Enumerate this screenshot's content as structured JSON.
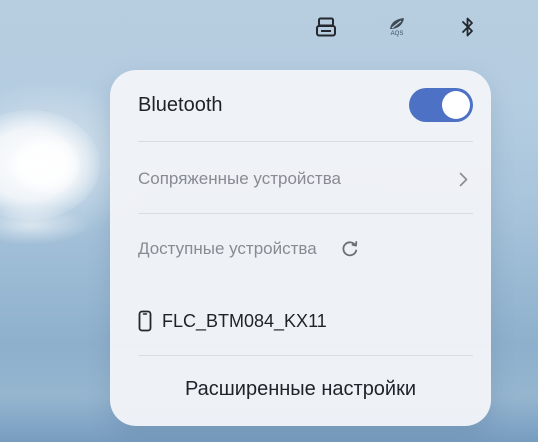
{
  "status_bar": {
    "icons": [
      {
        "name": "keyboard-icon"
      },
      {
        "name": "aqs-icon",
        "label": "AQS"
      },
      {
        "name": "bluetooth-icon"
      }
    ]
  },
  "panel": {
    "title": "Bluetooth",
    "toggle": {
      "on": true,
      "color": "#4d71c4"
    },
    "paired_devices_label": "Сопряженные устройства",
    "available_devices_label": "Доступные устройства",
    "devices": [
      {
        "icon": "phone-icon",
        "name": "FLC_BTM084_KX11"
      }
    ],
    "advanced_settings_label": "Расширенные настройки"
  }
}
